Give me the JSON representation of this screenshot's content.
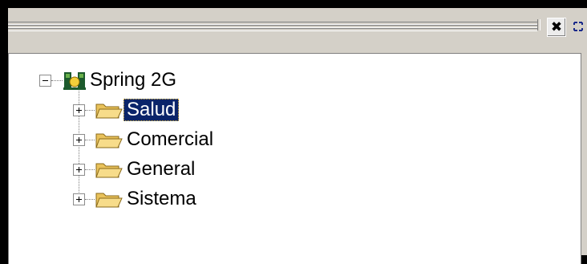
{
  "panel": {
    "close_icon": "close-icon",
    "float_icon": "float-icon"
  },
  "tree": {
    "root": {
      "label": "Spring 2G",
      "icon": "app-root-icon",
      "expanded": true
    },
    "children": [
      {
        "label": "Salud",
        "icon": "folder-icon",
        "selected": true
      },
      {
        "label": "Comercial",
        "icon": "folder-icon",
        "selected": false
      },
      {
        "label": "General",
        "icon": "folder-icon",
        "selected": false
      },
      {
        "label": "Sistema",
        "icon": "folder-icon",
        "selected": false
      }
    ]
  },
  "colors": {
    "selection": "#0a246a",
    "panel_bg": "#d4d0c8",
    "tree_bg": "#ffffff"
  }
}
